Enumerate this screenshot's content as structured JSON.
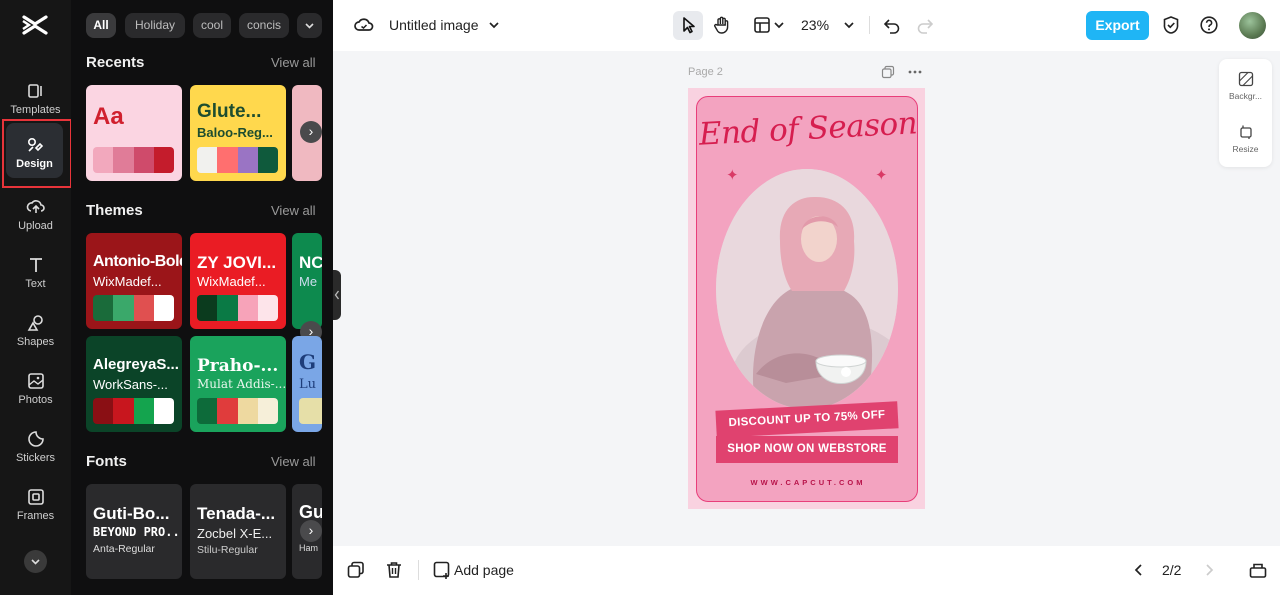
{
  "rail": {
    "items": [
      {
        "label": "Templates",
        "icon": "templates-icon"
      },
      {
        "label": "Design",
        "icon": "design-icon"
      },
      {
        "label": "Upload",
        "icon": "upload-icon"
      },
      {
        "label": "Text",
        "icon": "text-icon"
      },
      {
        "label": "Shapes",
        "icon": "shapes-icon"
      },
      {
        "label": "Photos",
        "icon": "photos-icon"
      },
      {
        "label": "Stickers",
        "icon": "stickers-icon"
      },
      {
        "label": "Frames",
        "icon": "frames-icon"
      }
    ]
  },
  "panel": {
    "chips": [
      "All",
      "Holiday",
      "cool",
      "concis"
    ],
    "view_all": "View all",
    "recents": {
      "title": "Recents",
      "cards": [
        {
          "heading": "Aa",
          "subtitle": ""
        },
        {
          "heading": "Glute...",
          "subtitle": "Baloo-Reg..."
        }
      ]
    },
    "themes": {
      "title": "Themes",
      "cards": [
        {
          "heading": "Antonio-Bold",
          "subtitle": "WixMadef..."
        },
        {
          "heading": "ZY JOVI...",
          "subtitle": "WixMadef..."
        },
        {
          "heading": "NC",
          "subtitle": "Me"
        },
        {
          "heading": "AlegreyaS...",
          "subtitle": "WorkSans-..."
        },
        {
          "heading": "Praho-...",
          "subtitle": "Mulat Addis-..."
        },
        {
          "heading": "G",
          "subtitle": "Lu"
        }
      ]
    },
    "fonts": {
      "title": "Fonts",
      "cards": [
        {
          "line1": "Guti-Bo...",
          "line2": "BEYOND PRO...",
          "line3": "Anta-Regular"
        },
        {
          "line1": "Tenada-...",
          "line2": "Zocbel X-E...",
          "line3": "Stilu-Regular"
        },
        {
          "line1": "Gu",
          "line2": "",
          "line3": "Ham"
        }
      ]
    }
  },
  "topbar": {
    "title": "Untitled image",
    "zoom": "23%",
    "export_label": "Export"
  },
  "canvas": {
    "page_label": "Page 2",
    "poster": {
      "title": "End of Season",
      "ribbon1": "DISCOUNT UP TO 75% OFF",
      "ribbon2": "SHOP NOW ON WEBSTORE",
      "url": "WWW.CAPCUT.COM"
    }
  },
  "right_panel": {
    "background_label": "Backgr...",
    "resize_label": "Resize"
  },
  "bottombar": {
    "add_page_label": "Add page",
    "page_counter": "2/2"
  },
  "colors": {
    "accent": "#1fb5f5",
    "active_outline": "#e8343a",
    "poster_pink": "#f3a3c0",
    "poster_red": "#d61e4f"
  }
}
